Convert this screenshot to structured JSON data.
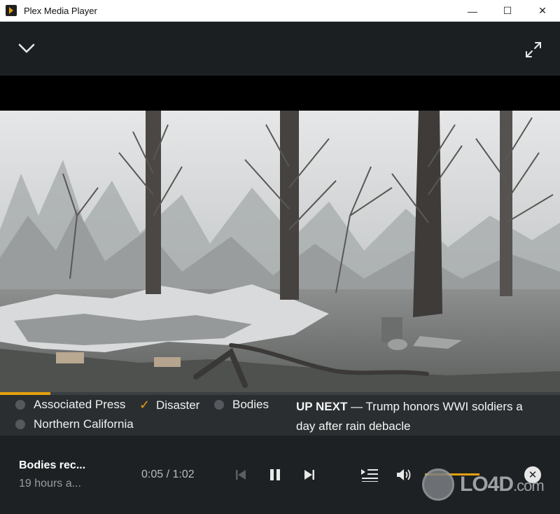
{
  "window": {
    "title": "Plex Media Player",
    "minimize_glyph": "—",
    "maximize_glyph": "☐",
    "close_glyph": "✕"
  },
  "player": {
    "progress_fraction": 0.09
  },
  "tags": [
    {
      "label": "Associated Press",
      "selected": false
    },
    {
      "label": "Disaster",
      "selected": true
    },
    {
      "label": "Bodies",
      "selected": false
    },
    {
      "label": "Northern California",
      "selected": false
    }
  ],
  "up_next": {
    "prefix": "UP NEXT",
    "title": "— Trump honors WWI soldiers a day after rain debacle"
  },
  "now_playing": {
    "title": "Bodies rec...",
    "subtitle": "19 hours a..."
  },
  "playback": {
    "time": "0:05 / 1:02",
    "close_glyph": "✕"
  },
  "watermark": {
    "text": "LO4D",
    "suffix": ".com"
  },
  "colors": {
    "accent": "#e5a00d",
    "bar_bg": "#1d2124",
    "info_bg": "#2a2e31"
  }
}
